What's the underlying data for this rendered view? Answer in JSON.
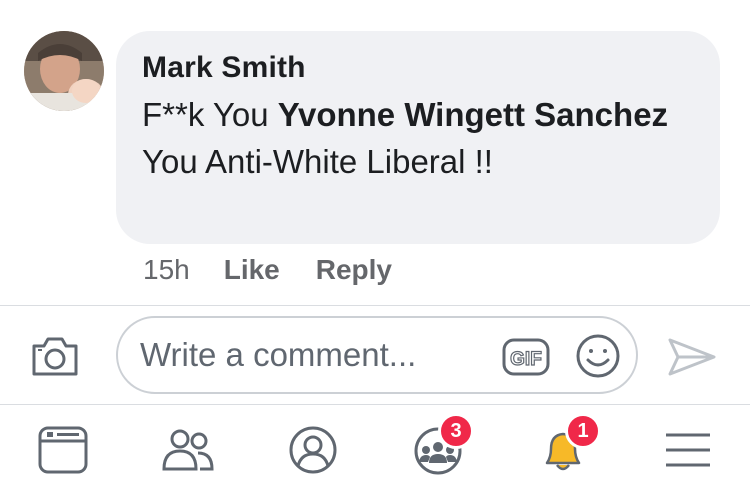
{
  "comment": {
    "author": "Mark Smith",
    "text_before": "F**k You ",
    "mention": "Yvonne Wingett Sanchez",
    "text_after": " You Anti-White Liberal !!",
    "time": "15h",
    "like_label": "Like",
    "reply_label": "Reply"
  },
  "composer": {
    "placeholder": "Write a comment...",
    "camera_icon": "camera-icon",
    "gif_icon": "gif-icon",
    "emoji_icon": "smiley-icon",
    "send_icon": "send-icon"
  },
  "tabbar": {
    "items": [
      {
        "icon": "news-feed-icon"
      },
      {
        "icon": "friends-icon"
      },
      {
        "icon": "profile-icon"
      },
      {
        "icon": "groups-icon",
        "badge": "3"
      },
      {
        "icon": "notifications-bell-icon",
        "badge": "1"
      },
      {
        "icon": "menu-icon"
      }
    ]
  },
  "colors": {
    "bubble": "#f0f1f4",
    "badge": "#f02849",
    "bell": "#f7b928",
    "icon_gray": "#606770"
  }
}
